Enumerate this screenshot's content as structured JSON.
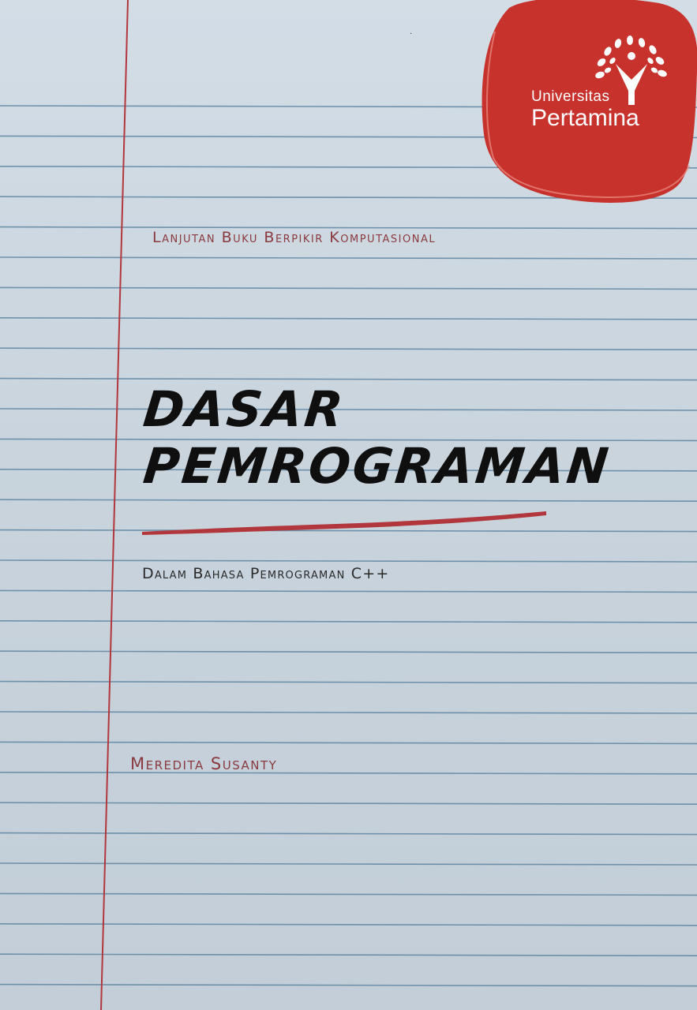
{
  "cover": {
    "publisher": {
      "line1": "Universitas",
      "line2": "Pertamina"
    },
    "supertitle": "Lanjutan Buku Berpikir Komputasional",
    "title": {
      "line1": "DASAR",
      "line2": "PEMROGRAMAN"
    },
    "subtitle": "Dalam Bahasa Pemrograman C++",
    "author": "Meredita Susanty"
  },
  "colors": {
    "paper": "#cfd9e2",
    "rule_line": "#5f86a3",
    "margin_line": "#b2373d",
    "seal_red": "#c8322c",
    "title_black": "#0f0f0f",
    "accent_text": "#8a3a3f"
  },
  "icons": {
    "publisher_logo": "person-with-leaves-icon"
  }
}
